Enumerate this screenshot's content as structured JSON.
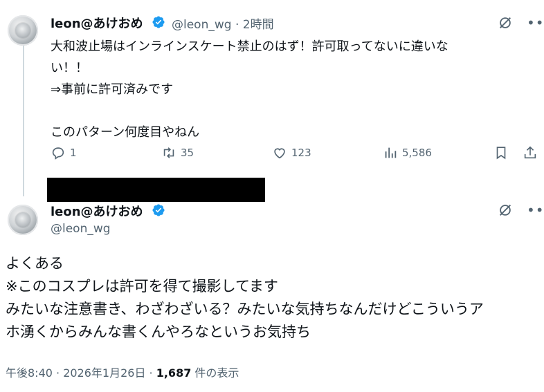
{
  "reply_tweet": {
    "author_name": "leon@あけおめ",
    "handle": "@leon_wg",
    "time": "· 2時間",
    "text": "大和波止場はインラインスケート禁止のはず！許可取ってないに違いな\nい！！\n⇒事前に許可済みです\n\nこのパターン何度目やねん",
    "actions": {
      "replies": "1",
      "retweets": "35",
      "likes": "123",
      "views": "5,586"
    }
  },
  "main_tweet": {
    "author_name": "leon@あけおめ",
    "handle": "@leon_wg",
    "text": "よくある\n※このコスプレは許可を得て撮影してます\nみたいな注意書き、わざわざいる？みたいな気持ちなんだけどこういうア\nホ湧くからみんな書くんやろなというお気持ち",
    "timestamp": "午後8:40 · 2026年1月26日 · ",
    "view_count": "1,687",
    "view_suffix": " 件の表示"
  },
  "colors": {
    "text": "#0f1419",
    "muted": "#536471",
    "verified": "#1d9bf0",
    "thread_line": "#cfd9de"
  },
  "icons": [
    "verified-badge-icon",
    "grok-icon",
    "more-icon",
    "reply-icon",
    "retweet-icon",
    "like-icon",
    "views-icon",
    "bookmark-icon",
    "share-icon"
  ]
}
